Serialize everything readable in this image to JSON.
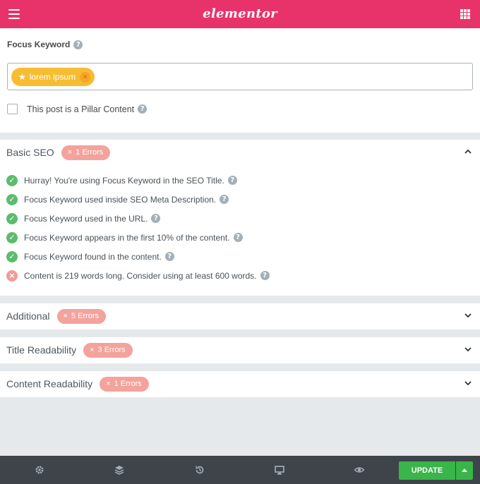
{
  "header": {
    "logo_text": "elementor"
  },
  "focus_keyword": {
    "label": "Focus Keyword",
    "help": "?",
    "tags": [
      {
        "text": "lorem ipsum",
        "remove": "×"
      }
    ],
    "pillar_label": "This post is a Pillar Content"
  },
  "sections": [
    {
      "title": "Basic SEO",
      "badge": "1 Errors",
      "expanded": true,
      "checks": [
        {
          "status": "pass",
          "text": "Hurray! You're using Focus Keyword in the SEO Title."
        },
        {
          "status": "pass",
          "text": "Focus Keyword used inside SEO Meta Description."
        },
        {
          "status": "pass",
          "text": "Focus Keyword used in the URL."
        },
        {
          "status": "pass",
          "text": "Focus Keyword appears in the first 10% of the content."
        },
        {
          "status": "pass",
          "text": "Focus Keyword found in the content."
        },
        {
          "status": "fail",
          "text": "Content is 219 words long. Consider using at least 600 words."
        }
      ]
    },
    {
      "title": "Additional",
      "badge": "5 Errors",
      "expanded": false
    },
    {
      "title": "Title Readability",
      "badge": "3 Errors",
      "expanded": false
    },
    {
      "title": "Content Readability",
      "badge": "1 Errors",
      "expanded": false
    }
  ],
  "footer": {
    "icons": [
      "settings-icon",
      "layers-icon",
      "history-icon",
      "responsive-icon",
      "preview-icon"
    ],
    "update_label": "UPDATE"
  },
  "colors": {
    "brand": "#e8336a",
    "pass": "#5dbb6d",
    "error_badge": "#f4a29c",
    "tag": "#f7bd32",
    "update": "#39b54a"
  }
}
